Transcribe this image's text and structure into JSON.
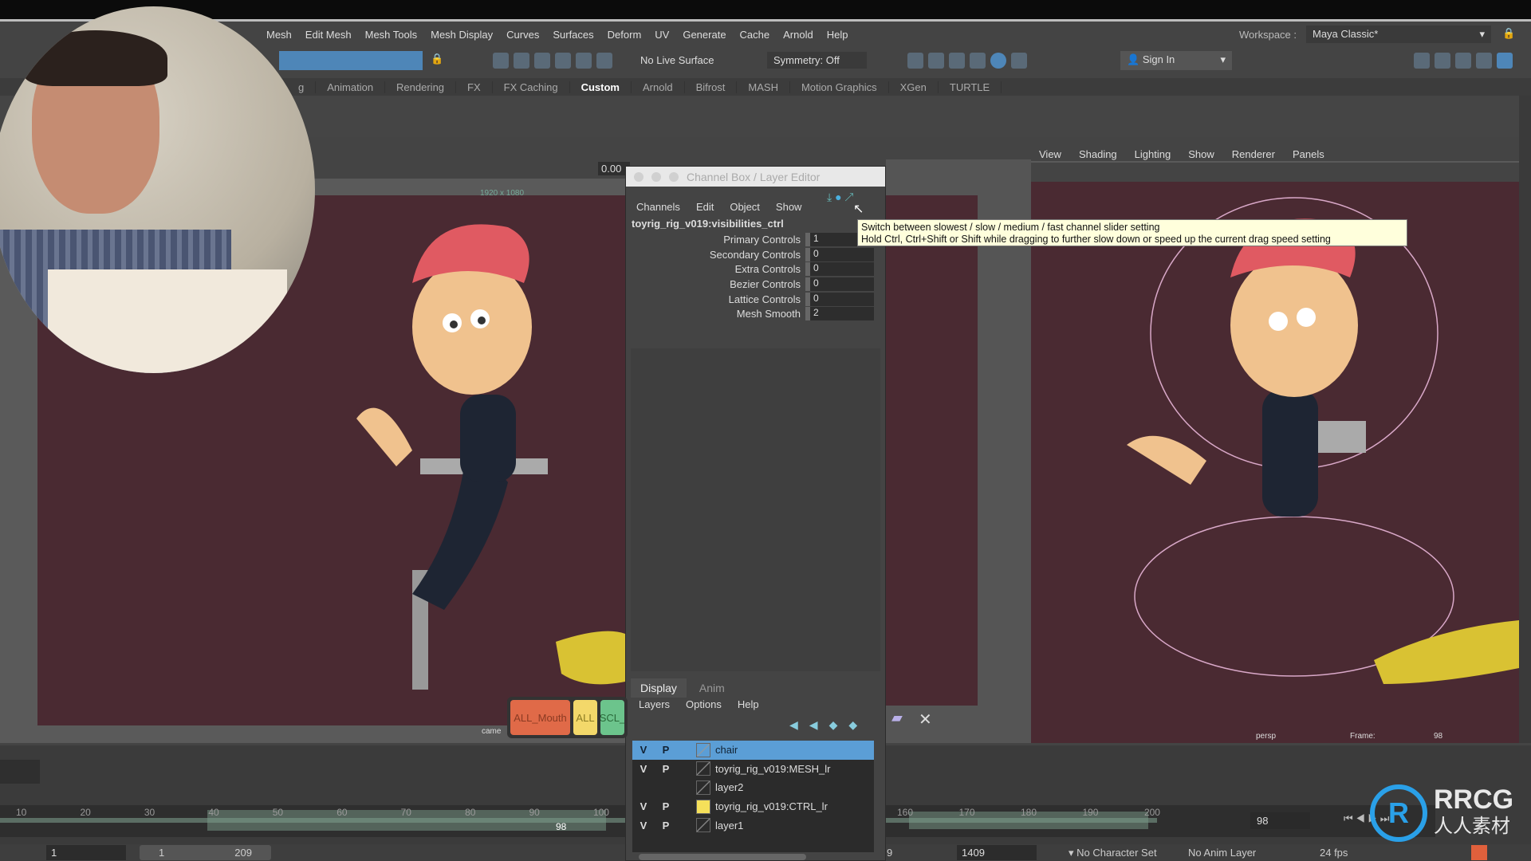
{
  "menubar": {
    "items": [
      "Mesh",
      "Edit Mesh",
      "Mesh Tools",
      "Mesh Display",
      "Curves",
      "Surfaces",
      "Deform",
      "UV",
      "Generate",
      "Cache",
      "Arnold",
      "Help"
    ],
    "workspace_label": "Workspace :",
    "workspace_value": "Maya Classic*"
  },
  "toolbar": {
    "live_surface": "No Live Surface",
    "symmetry": "Symmetry: Off",
    "sign_in": "Sign In"
  },
  "shelf": {
    "tabs": [
      "g",
      "Animation",
      "Rendering",
      "FX",
      "FX Caching",
      "Custom",
      "Arnold",
      "Bifrost",
      "MASH",
      "Motion Graphics",
      "XGen",
      "TURTLE"
    ],
    "active": "Custom"
  },
  "left_viewport": {
    "field_value": "0.00",
    "resolution": "1920 x 1080",
    "camera_label": "came"
  },
  "channel_box": {
    "title": "Channel Box / Layer Editor",
    "menus": [
      "Channels",
      "Edit",
      "Object",
      "Show"
    ],
    "object_name": "toyrig_rig_v019:visibilities_ctrl",
    "attributes": [
      {
        "label": "Primary Controls",
        "value": "1"
      },
      {
        "label": "Secondary Controls",
        "value": "0"
      },
      {
        "label": "Extra Controls",
        "value": "0"
      },
      {
        "label": "Bezier Controls",
        "value": "0"
      },
      {
        "label": "Lattice Controls",
        "value": "0"
      },
      {
        "label": "Mesh Smooth",
        "value": "2"
      }
    ],
    "tooltip_line1": "Switch between slowest / slow / medium / fast channel slider setting",
    "tooltip_line2": "Hold Ctrl, Ctrl+Shift or Shift while dragging to further slow down or speed up the current drag speed setting",
    "layer_tabs": [
      "Display",
      "Anim"
    ],
    "active_layer_tab": "Display",
    "layer_menus": [
      "Layers",
      "Options",
      "Help"
    ],
    "layers": [
      {
        "v": "V",
        "p": "P",
        "name": "chair",
        "selected": true,
        "color": ""
      },
      {
        "v": "V",
        "p": "P",
        "name": "toyrig_rig_v019:MESH_lr",
        "selected": false,
        "color": ""
      },
      {
        "v": "",
        "p": "",
        "name": "layer2",
        "selected": false,
        "color": ""
      },
      {
        "v": "V",
        "p": "P",
        "name": "toyrig_rig_v019:CTRL_lr",
        "selected": false,
        "color": "#f5e05a"
      },
      {
        "v": "V",
        "p": "P",
        "name": "layer1",
        "selected": false,
        "color": ""
      }
    ]
  },
  "selection_buttons": [
    {
      "label": "ALL_Mouth",
      "color": "#e06a48"
    },
    {
      "label": "ALL",
      "color": "#f3d86a"
    },
    {
      "label": "SCL_",
      "color": "#6cc48c"
    }
  ],
  "right_viewport": {
    "menus": [
      "View",
      "Shading",
      "Lighting",
      "Show",
      "Renderer",
      "Panels"
    ],
    "camera_label": "persp",
    "frame_label": "Frame:",
    "frame_value": "98"
  },
  "timeline": {
    "ticks_left": [
      "10",
      "20",
      "30",
      "40",
      "50",
      "60",
      "70",
      "80",
      "90",
      "100"
    ],
    "ticks_right": [
      "160",
      "170",
      "180",
      "190",
      "200"
    ],
    "current_frame_marker": "98",
    "current_frame": "98",
    "range_start": "1",
    "range_slider_start": "1",
    "range_slider_end": "209",
    "range_end_partial": "9",
    "anim_end": "1409",
    "character_set": "No Character Set",
    "anim_layer": "No Anim Layer",
    "fps": "24 fps"
  },
  "watermark": {
    "brand": "RRCG",
    "sub": "人人素材"
  },
  "colors": {
    "accent": "#5b9ed6",
    "viewport_bg": "#4a2a32",
    "tooltip_bg": "#ffffdc"
  }
}
